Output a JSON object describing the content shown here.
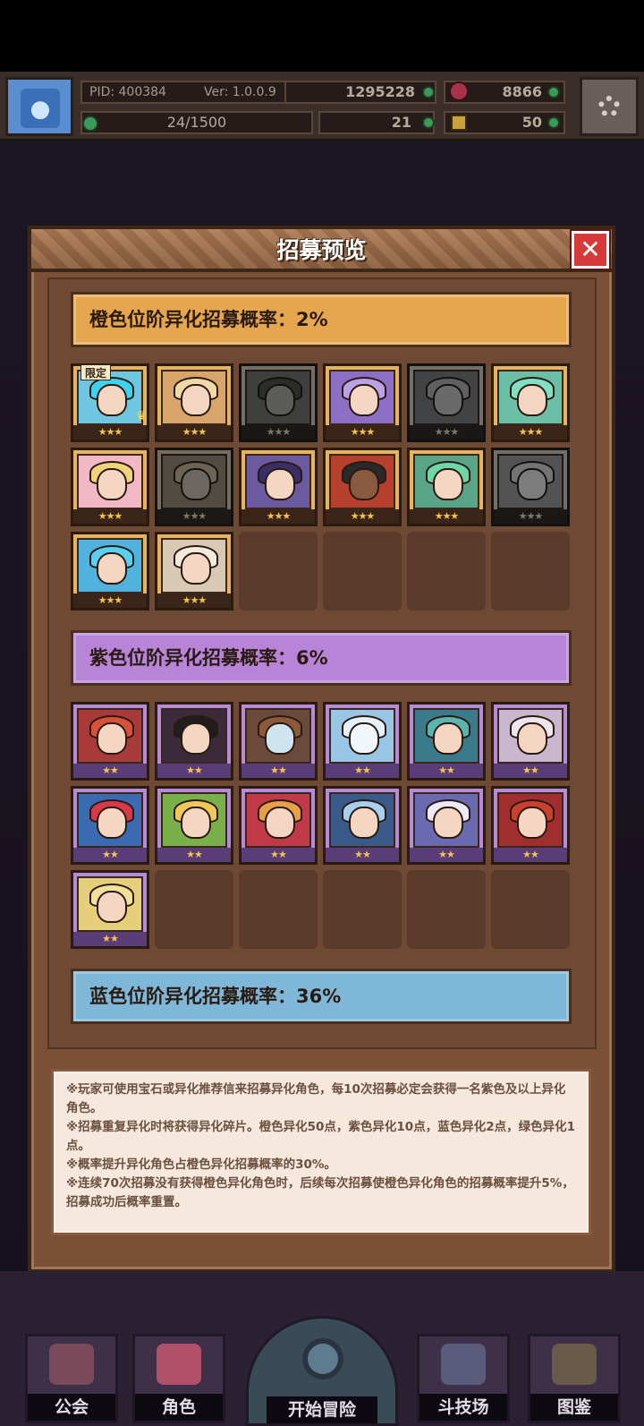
{
  "hud": {
    "pid": "PID: 400384",
    "version": "Ver: 1.0.0.9",
    "gold": "1295228",
    "gems": "8866",
    "exp_bar": "24/1500",
    "clover_count": "21",
    "key_count": "50"
  },
  "dialog": {
    "title": "招募预览",
    "close_symbol": "✕",
    "rates": {
      "orange": "橙色位阶异化招募概率：2%",
      "purple": "紫色位阶异化招募概率：6%",
      "blue": "蓝色位阶异化招募概率：36%"
    },
    "limited_badge": "限定",
    "three_stars": "★★★",
    "two_stars": "★★",
    "notes": [
      "※玩家可使用宝石或异化推荐信来招募异化角色，每10次招募必定会获得一名紫色及以上异化角色。",
      "※招募重复异化时将获得异化碎片。橙色异化50点，紫色异化10点，蓝色异化2点，绿色异化1点。",
      "※概率提升异化角色占橙色异化招募概率的30%。",
      "※连续70次招募没有获得橙色异化角色时，后续每次招募使橙色异化角色的招募概率提升5%，招募成功后概率重置。"
    ]
  },
  "bottom_nav": {
    "guild": "公会",
    "characters": "角色",
    "adventure": "开始冒险",
    "arena": "斗技场",
    "codex": "图鉴"
  },
  "colors": {
    "orange_tier": "#e6a64e",
    "purple_tier": "#b884d8",
    "blue_tier": "#7fb7d9",
    "close_red": "#d6393a"
  }
}
